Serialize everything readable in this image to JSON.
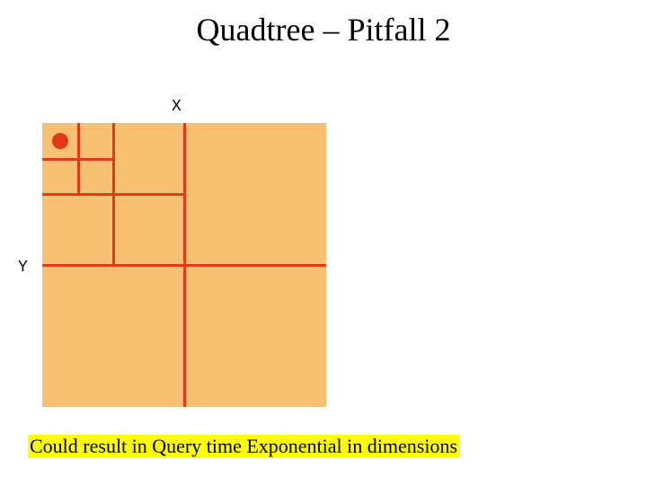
{
  "title": "Quadtree – Pitfall 2",
  "axis": {
    "x": "X",
    "y": "Y"
  },
  "caption": "Could result in Query time Exponential in dimensions",
  "chart_data": {
    "type": "quadtree-diagram",
    "domain": {
      "x": [
        0,
        1
      ],
      "y": [
        0,
        1
      ]
    },
    "points": [
      {
        "x": 0.065,
        "y": 0.94
      }
    ],
    "subdivisions": [
      {
        "level": 0,
        "cell": [
          0,
          0,
          1,
          1
        ]
      },
      {
        "level": 1,
        "cell": [
          0,
          0.5,
          0.5,
          1
        ]
      },
      {
        "level": 2,
        "cell": [
          0,
          0.75,
          0.25,
          1
        ]
      }
    ],
    "colors": {
      "fill": "#f7c173",
      "lines": "#e13a1a",
      "point": "#e13a1a",
      "highlight": "#ffff00"
    }
  }
}
